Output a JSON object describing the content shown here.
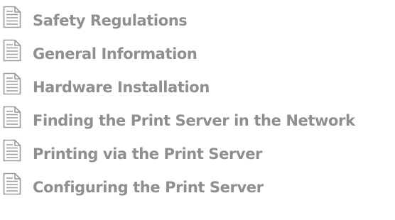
{
  "toc": {
    "icon": "document-icon",
    "items": [
      {
        "label": "Safety Regulations"
      },
      {
        "label": "General Information"
      },
      {
        "label": "Hardware Installation"
      },
      {
        "label": "Finding the Print Server in the Network"
      },
      {
        "label": "Printing via the Print Server"
      },
      {
        "label": "Configuring the Print Server"
      }
    ]
  },
  "colors": {
    "text": "#8f8f8f",
    "icon": "#9a9a9a",
    "background": "#ffffff"
  }
}
